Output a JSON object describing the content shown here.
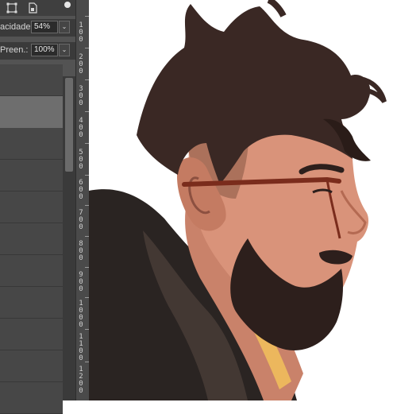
{
  "options_bar": {
    "icons": [
      "transform-icon",
      "document-icon"
    ],
    "opacity_label": "acidade:",
    "opacity_value": "54%",
    "fill_label": "Preen.:",
    "fill_value": "100%"
  },
  "ruler": {
    "labels": [
      "1\n0\n0",
      "2\n0\n0",
      "3\n0\n0",
      "4\n0\n0",
      "5\n0\n0",
      "6\n0\n0",
      "7\n0\n0",
      "8\n0\n0",
      "9\n0\n0",
      "1\n0\n0\n0",
      "1\n1\n0\n0",
      "1\n2\n0\n0"
    ]
  },
  "canvas": {
    "image": "portrait-illustration",
    "colors": {
      "hair": "#3a2824",
      "skin": "#d9937a",
      "skin_shadow": "#9b6652",
      "beard": "#2d1f1c",
      "jacket": "#2a2422",
      "glasses": "#7a2c1c",
      "highlight": "#f2c15a"
    }
  },
  "colors": {
    "panel_bg": "#535353",
    "selected_layer": "#6e6e6e"
  }
}
